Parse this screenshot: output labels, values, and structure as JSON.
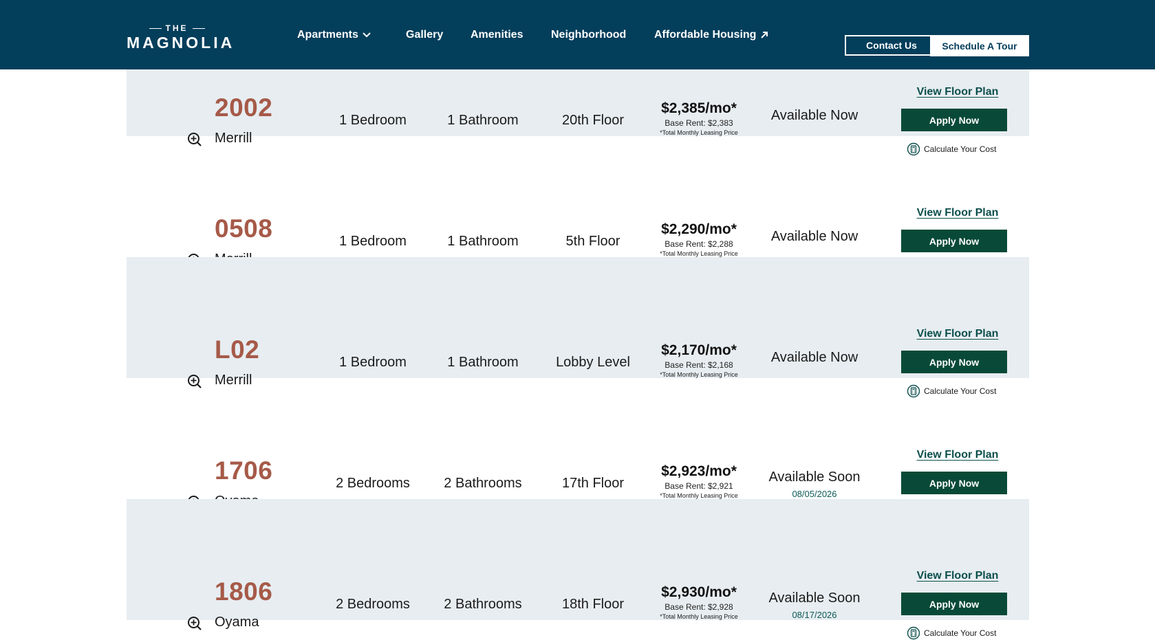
{
  "header": {
    "logo_small": "THE",
    "logo_main": "MAGNOLIA",
    "nav": [
      {
        "label": "Apartments",
        "icon": "chevron-down-icon"
      },
      {
        "label": "Gallery"
      },
      {
        "label": "Amenities"
      },
      {
        "label": "Neighborhood"
      },
      {
        "label": "Affordable Housing",
        "icon": "external-link-icon"
      }
    ],
    "contact_label": "Contact Us",
    "tour_label": "Schedule A Tour"
  },
  "colors": {
    "header_bg": "#033e5b",
    "unit_number": "#a65a48",
    "apply_button": "#084a37",
    "row_shade": "#e7edf1",
    "link": "#0c4e4c"
  },
  "listing": {
    "floor_plan_label": "View Floor Plan",
    "apply_label": "Apply Now",
    "calc_label": "Calculate Your Cost",
    "total_note": "*Total Monthly Leasing Price",
    "units": [
      {
        "number": "2002",
        "building": "Merrill",
        "beds": "1 Bedroom",
        "baths": "1 Bathroom",
        "floor": "20th Floor",
        "price": "$2,385/mo*",
        "base_rent": "Base Rent: $2,383",
        "availability": "Available Now",
        "date": ""
      },
      {
        "number": "0508",
        "building": "Merrill",
        "beds": "1 Bedroom",
        "baths": "1 Bathroom",
        "floor": "5th Floor",
        "price": "$2,290/mo*",
        "base_rent": "Base Rent: $2,288",
        "availability": "Available Now",
        "date": ""
      },
      {
        "number": "L02",
        "building": "Merrill",
        "beds": "1 Bedroom",
        "baths": "1 Bathroom",
        "floor": "Lobby Level",
        "price": "$2,170/mo*",
        "base_rent": "Base Rent: $2,168",
        "availability": "Available Now",
        "date": ""
      },
      {
        "number": "1706",
        "building": "Oyama",
        "beds": "2 Bedrooms",
        "baths": "2 Bathrooms",
        "floor": "17th Floor",
        "price": "$2,923/mo*",
        "base_rent": "Base Rent: $2,921",
        "availability": "Available Soon",
        "date": "08/05/2026"
      },
      {
        "number": "1806",
        "building": "Oyama",
        "beds": "2 Bedrooms",
        "baths": "2 Bathrooms",
        "floor": "18th Floor",
        "price": "$2,930/mo*",
        "base_rent": "Base Rent: $2,928",
        "availability": "Available Soon",
        "date": "08/17/2026"
      }
    ]
  }
}
